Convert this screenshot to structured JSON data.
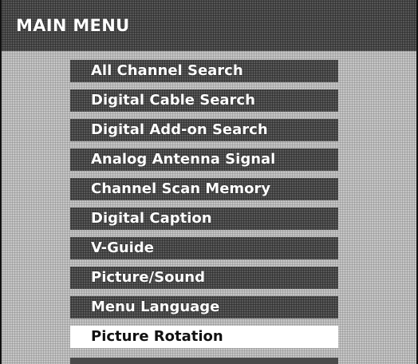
{
  "menu": {
    "title": "MAIN MENU",
    "selected_index": 9,
    "items": [
      {
        "label": "All Channel Search"
      },
      {
        "label": "Digital Cable Search"
      },
      {
        "label": "Digital Add-on Search"
      },
      {
        "label": "Analog Antenna Signal"
      },
      {
        "label": "Channel Scan Memory"
      },
      {
        "label": "Digital Caption"
      },
      {
        "label": "V-Guide"
      },
      {
        "label": "Picture/Sound"
      },
      {
        "label": "Menu Language"
      },
      {
        "label": "Picture Rotation"
      }
    ]
  }
}
